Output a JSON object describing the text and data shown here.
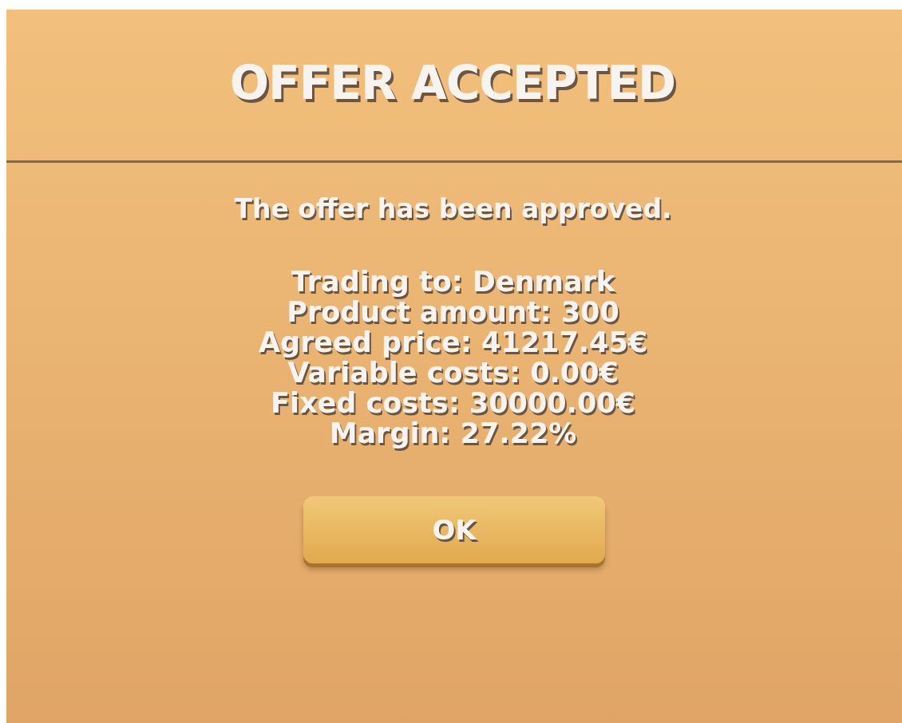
{
  "dialog": {
    "title": "OFFER ACCEPTED",
    "message": "The offer has been approved.",
    "details": [
      "Trading to: Denmark",
      "Product amount: 300",
      "Agreed price: 41217.45€",
      "Variable costs: 0.00€",
      "Fixed costs: 30000.00€",
      "Margin: 27.22%"
    ],
    "button": {
      "label": "OK"
    }
  }
}
